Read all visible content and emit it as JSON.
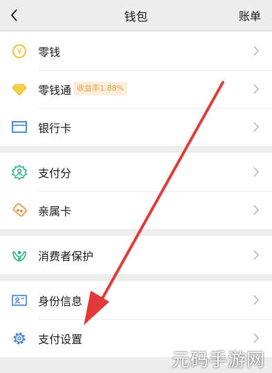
{
  "header": {
    "title": "钱包",
    "bill_label": "账单"
  },
  "items": {
    "change": {
      "label": "零钱"
    },
    "lqt": {
      "label": "零钱通",
      "badge": "收益率1.88%"
    },
    "bank": {
      "label": "银行卡"
    },
    "pay_score": {
      "label": "支付分"
    },
    "family_card": {
      "label": "亲属卡"
    },
    "protection": {
      "label": "消费者保护"
    },
    "identity": {
      "label": "身份信息"
    },
    "pay_settings": {
      "label": "支付设置"
    }
  },
  "watermark": "元码手游网",
  "colors": {
    "accent": "#07c160",
    "gold": "#f0c020",
    "blue": "#3e7fd6",
    "annotation_arrow": "#e33838"
  }
}
